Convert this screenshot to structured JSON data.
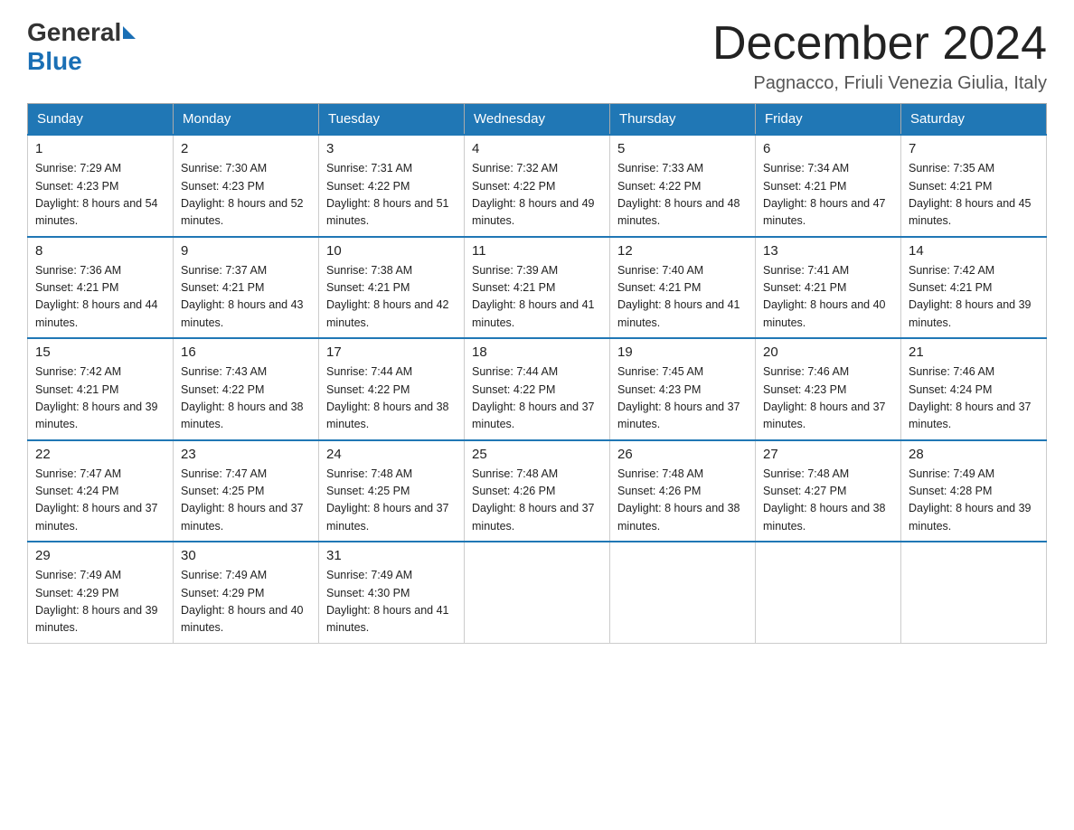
{
  "header": {
    "logo_general": "General",
    "logo_blue": "Blue",
    "month_title": "December 2024",
    "location": "Pagnacco, Friuli Venezia Giulia, Italy"
  },
  "days_of_week": [
    "Sunday",
    "Monday",
    "Tuesday",
    "Wednesday",
    "Thursday",
    "Friday",
    "Saturday"
  ],
  "weeks": [
    [
      {
        "day": "1",
        "sunrise": "7:29 AM",
        "sunset": "4:23 PM",
        "daylight": "8 hours and 54 minutes."
      },
      {
        "day": "2",
        "sunrise": "7:30 AM",
        "sunset": "4:23 PM",
        "daylight": "8 hours and 52 minutes."
      },
      {
        "day": "3",
        "sunrise": "7:31 AM",
        "sunset": "4:22 PM",
        "daylight": "8 hours and 51 minutes."
      },
      {
        "day": "4",
        "sunrise": "7:32 AM",
        "sunset": "4:22 PM",
        "daylight": "8 hours and 49 minutes."
      },
      {
        "day": "5",
        "sunrise": "7:33 AM",
        "sunset": "4:22 PM",
        "daylight": "8 hours and 48 minutes."
      },
      {
        "day": "6",
        "sunrise": "7:34 AM",
        "sunset": "4:21 PM",
        "daylight": "8 hours and 47 minutes."
      },
      {
        "day": "7",
        "sunrise": "7:35 AM",
        "sunset": "4:21 PM",
        "daylight": "8 hours and 45 minutes."
      }
    ],
    [
      {
        "day": "8",
        "sunrise": "7:36 AM",
        "sunset": "4:21 PM",
        "daylight": "8 hours and 44 minutes."
      },
      {
        "day": "9",
        "sunrise": "7:37 AM",
        "sunset": "4:21 PM",
        "daylight": "8 hours and 43 minutes."
      },
      {
        "day": "10",
        "sunrise": "7:38 AM",
        "sunset": "4:21 PM",
        "daylight": "8 hours and 42 minutes."
      },
      {
        "day": "11",
        "sunrise": "7:39 AM",
        "sunset": "4:21 PM",
        "daylight": "8 hours and 41 minutes."
      },
      {
        "day": "12",
        "sunrise": "7:40 AM",
        "sunset": "4:21 PM",
        "daylight": "8 hours and 41 minutes."
      },
      {
        "day": "13",
        "sunrise": "7:41 AM",
        "sunset": "4:21 PM",
        "daylight": "8 hours and 40 minutes."
      },
      {
        "day": "14",
        "sunrise": "7:42 AM",
        "sunset": "4:21 PM",
        "daylight": "8 hours and 39 minutes."
      }
    ],
    [
      {
        "day": "15",
        "sunrise": "7:42 AM",
        "sunset": "4:21 PM",
        "daylight": "8 hours and 39 minutes."
      },
      {
        "day": "16",
        "sunrise": "7:43 AM",
        "sunset": "4:22 PM",
        "daylight": "8 hours and 38 minutes."
      },
      {
        "day": "17",
        "sunrise": "7:44 AM",
        "sunset": "4:22 PM",
        "daylight": "8 hours and 38 minutes."
      },
      {
        "day": "18",
        "sunrise": "7:44 AM",
        "sunset": "4:22 PM",
        "daylight": "8 hours and 37 minutes."
      },
      {
        "day": "19",
        "sunrise": "7:45 AM",
        "sunset": "4:23 PM",
        "daylight": "8 hours and 37 minutes."
      },
      {
        "day": "20",
        "sunrise": "7:46 AM",
        "sunset": "4:23 PM",
        "daylight": "8 hours and 37 minutes."
      },
      {
        "day": "21",
        "sunrise": "7:46 AM",
        "sunset": "4:24 PM",
        "daylight": "8 hours and 37 minutes."
      }
    ],
    [
      {
        "day": "22",
        "sunrise": "7:47 AM",
        "sunset": "4:24 PM",
        "daylight": "8 hours and 37 minutes."
      },
      {
        "day": "23",
        "sunrise": "7:47 AM",
        "sunset": "4:25 PM",
        "daylight": "8 hours and 37 minutes."
      },
      {
        "day": "24",
        "sunrise": "7:48 AM",
        "sunset": "4:25 PM",
        "daylight": "8 hours and 37 minutes."
      },
      {
        "day": "25",
        "sunrise": "7:48 AM",
        "sunset": "4:26 PM",
        "daylight": "8 hours and 37 minutes."
      },
      {
        "day": "26",
        "sunrise": "7:48 AM",
        "sunset": "4:26 PM",
        "daylight": "8 hours and 38 minutes."
      },
      {
        "day": "27",
        "sunrise": "7:48 AM",
        "sunset": "4:27 PM",
        "daylight": "8 hours and 38 minutes."
      },
      {
        "day": "28",
        "sunrise": "7:49 AM",
        "sunset": "4:28 PM",
        "daylight": "8 hours and 39 minutes."
      }
    ],
    [
      {
        "day": "29",
        "sunrise": "7:49 AM",
        "sunset": "4:29 PM",
        "daylight": "8 hours and 39 minutes."
      },
      {
        "day": "30",
        "sunrise": "7:49 AM",
        "sunset": "4:29 PM",
        "daylight": "8 hours and 40 minutes."
      },
      {
        "day": "31",
        "sunrise": "7:49 AM",
        "sunset": "4:30 PM",
        "daylight": "8 hours and 41 minutes."
      },
      null,
      null,
      null,
      null
    ]
  ]
}
